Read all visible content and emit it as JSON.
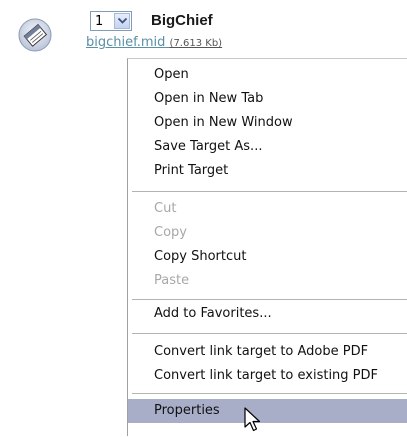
{
  "entry": {
    "icon": "midi-file-icon",
    "select_value": "1",
    "title": "BigChief",
    "file_link": "bigchief.mid",
    "file_size": "(7.613 Kb)"
  },
  "context_menu": {
    "open": "Open",
    "open_new_tab": "Open in New Tab",
    "open_new_window": "Open in New Window",
    "save_target_as": "Save Target As...",
    "print_target": "Print Target",
    "cut": "Cut",
    "copy": "Copy",
    "copy_shortcut": "Copy Shortcut",
    "paste": "Paste",
    "add_to_favorites": "Add to Favorites...",
    "convert_adobe_pdf": "Convert link target to Adobe PDF",
    "convert_existing_pdf": "Convert link target to existing PDF",
    "properties": "Properties"
  },
  "colors": {
    "link": "#5a8fa6",
    "highlight": "#a8aec8",
    "disabled_text": "#a8a8a8"
  }
}
